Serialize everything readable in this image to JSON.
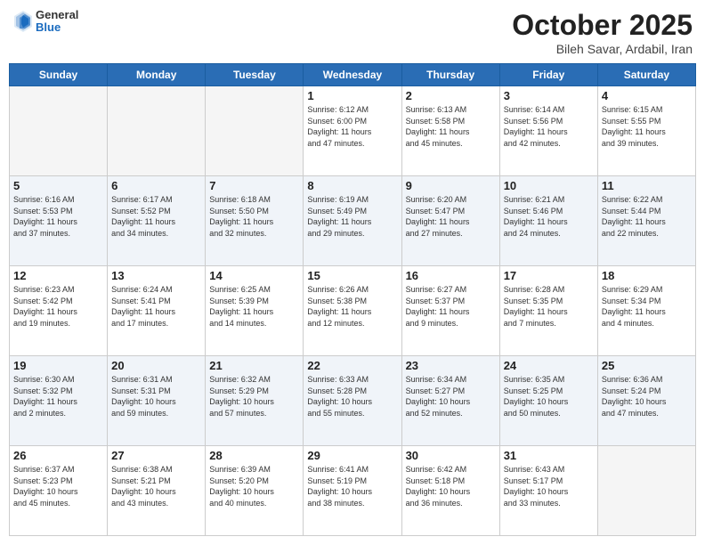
{
  "header": {
    "logo_general": "General",
    "logo_blue": "Blue",
    "title": "October 2025",
    "location": "Bileh Savar, Ardabil, Iran"
  },
  "weekdays": [
    "Sunday",
    "Monday",
    "Tuesday",
    "Wednesday",
    "Thursday",
    "Friday",
    "Saturday"
  ],
  "weeks": [
    [
      {
        "day": "",
        "info": ""
      },
      {
        "day": "",
        "info": ""
      },
      {
        "day": "",
        "info": ""
      },
      {
        "day": "1",
        "info": "Sunrise: 6:12 AM\nSunset: 6:00 PM\nDaylight: 11 hours\nand 47 minutes."
      },
      {
        "day": "2",
        "info": "Sunrise: 6:13 AM\nSunset: 5:58 PM\nDaylight: 11 hours\nand 45 minutes."
      },
      {
        "day": "3",
        "info": "Sunrise: 6:14 AM\nSunset: 5:56 PM\nDaylight: 11 hours\nand 42 minutes."
      },
      {
        "day": "4",
        "info": "Sunrise: 6:15 AM\nSunset: 5:55 PM\nDaylight: 11 hours\nand 39 minutes."
      }
    ],
    [
      {
        "day": "5",
        "info": "Sunrise: 6:16 AM\nSunset: 5:53 PM\nDaylight: 11 hours\nand 37 minutes."
      },
      {
        "day": "6",
        "info": "Sunrise: 6:17 AM\nSunset: 5:52 PM\nDaylight: 11 hours\nand 34 minutes."
      },
      {
        "day": "7",
        "info": "Sunrise: 6:18 AM\nSunset: 5:50 PM\nDaylight: 11 hours\nand 32 minutes."
      },
      {
        "day": "8",
        "info": "Sunrise: 6:19 AM\nSunset: 5:49 PM\nDaylight: 11 hours\nand 29 minutes."
      },
      {
        "day": "9",
        "info": "Sunrise: 6:20 AM\nSunset: 5:47 PM\nDaylight: 11 hours\nand 27 minutes."
      },
      {
        "day": "10",
        "info": "Sunrise: 6:21 AM\nSunset: 5:46 PM\nDaylight: 11 hours\nand 24 minutes."
      },
      {
        "day": "11",
        "info": "Sunrise: 6:22 AM\nSunset: 5:44 PM\nDaylight: 11 hours\nand 22 minutes."
      }
    ],
    [
      {
        "day": "12",
        "info": "Sunrise: 6:23 AM\nSunset: 5:42 PM\nDaylight: 11 hours\nand 19 minutes."
      },
      {
        "day": "13",
        "info": "Sunrise: 6:24 AM\nSunset: 5:41 PM\nDaylight: 11 hours\nand 17 minutes."
      },
      {
        "day": "14",
        "info": "Sunrise: 6:25 AM\nSunset: 5:39 PM\nDaylight: 11 hours\nand 14 minutes."
      },
      {
        "day": "15",
        "info": "Sunrise: 6:26 AM\nSunset: 5:38 PM\nDaylight: 11 hours\nand 12 minutes."
      },
      {
        "day": "16",
        "info": "Sunrise: 6:27 AM\nSunset: 5:37 PM\nDaylight: 11 hours\nand 9 minutes."
      },
      {
        "day": "17",
        "info": "Sunrise: 6:28 AM\nSunset: 5:35 PM\nDaylight: 11 hours\nand 7 minutes."
      },
      {
        "day": "18",
        "info": "Sunrise: 6:29 AM\nSunset: 5:34 PM\nDaylight: 11 hours\nand 4 minutes."
      }
    ],
    [
      {
        "day": "19",
        "info": "Sunrise: 6:30 AM\nSunset: 5:32 PM\nDaylight: 11 hours\nand 2 minutes."
      },
      {
        "day": "20",
        "info": "Sunrise: 6:31 AM\nSunset: 5:31 PM\nDaylight: 10 hours\nand 59 minutes."
      },
      {
        "day": "21",
        "info": "Sunrise: 6:32 AM\nSunset: 5:29 PM\nDaylight: 10 hours\nand 57 minutes."
      },
      {
        "day": "22",
        "info": "Sunrise: 6:33 AM\nSunset: 5:28 PM\nDaylight: 10 hours\nand 55 minutes."
      },
      {
        "day": "23",
        "info": "Sunrise: 6:34 AM\nSunset: 5:27 PM\nDaylight: 10 hours\nand 52 minutes."
      },
      {
        "day": "24",
        "info": "Sunrise: 6:35 AM\nSunset: 5:25 PM\nDaylight: 10 hours\nand 50 minutes."
      },
      {
        "day": "25",
        "info": "Sunrise: 6:36 AM\nSunset: 5:24 PM\nDaylight: 10 hours\nand 47 minutes."
      }
    ],
    [
      {
        "day": "26",
        "info": "Sunrise: 6:37 AM\nSunset: 5:23 PM\nDaylight: 10 hours\nand 45 minutes."
      },
      {
        "day": "27",
        "info": "Sunrise: 6:38 AM\nSunset: 5:21 PM\nDaylight: 10 hours\nand 43 minutes."
      },
      {
        "day": "28",
        "info": "Sunrise: 6:39 AM\nSunset: 5:20 PM\nDaylight: 10 hours\nand 40 minutes."
      },
      {
        "day": "29",
        "info": "Sunrise: 6:41 AM\nSunset: 5:19 PM\nDaylight: 10 hours\nand 38 minutes."
      },
      {
        "day": "30",
        "info": "Sunrise: 6:42 AM\nSunset: 5:18 PM\nDaylight: 10 hours\nand 36 minutes."
      },
      {
        "day": "31",
        "info": "Sunrise: 6:43 AM\nSunset: 5:17 PM\nDaylight: 10 hours\nand 33 minutes."
      },
      {
        "day": "",
        "info": ""
      }
    ]
  ]
}
